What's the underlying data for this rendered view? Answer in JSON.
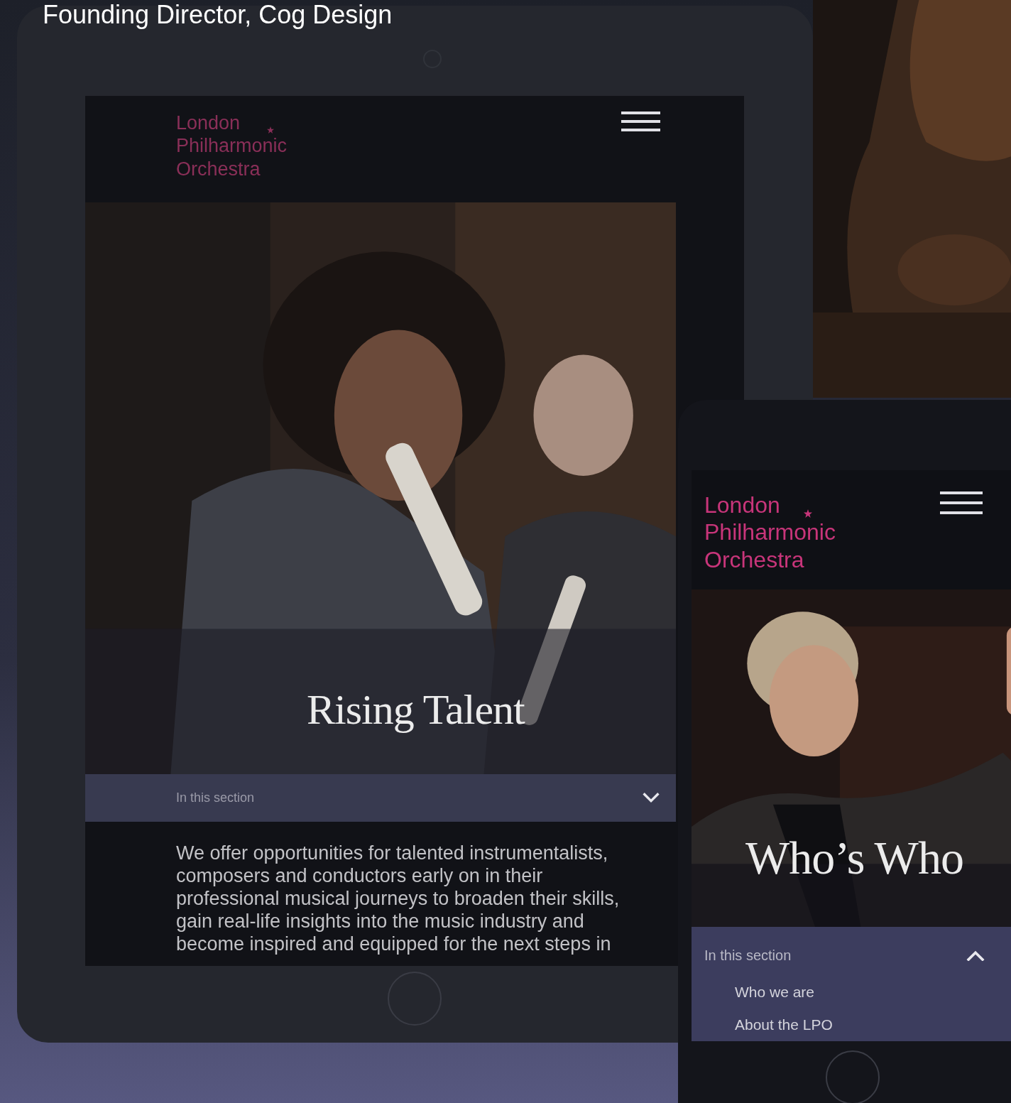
{
  "caption": "Founding Director, Cog Design",
  "tablet": {
    "logo": [
      "London",
      "Philharmonic",
      "Orchestra"
    ],
    "hero_title": "Rising Talent",
    "section_menu": {
      "label": "In this section",
      "expanded": false
    },
    "intro": "We offer opportunities for talented instrumentalists, composers and conductors early on in their professional musical journeys to broaden their skills, gain real-life insights into the music industry and become inspired and equipped for the next steps in"
  },
  "phone": {
    "logo": [
      "London",
      "Philharmonic",
      "Orchestra"
    ],
    "hero_title": "Who’s Who",
    "section_menu": {
      "label": "In this section",
      "expanded": true,
      "items": [
        "Who we are",
        "About the LPO"
      ]
    }
  }
}
